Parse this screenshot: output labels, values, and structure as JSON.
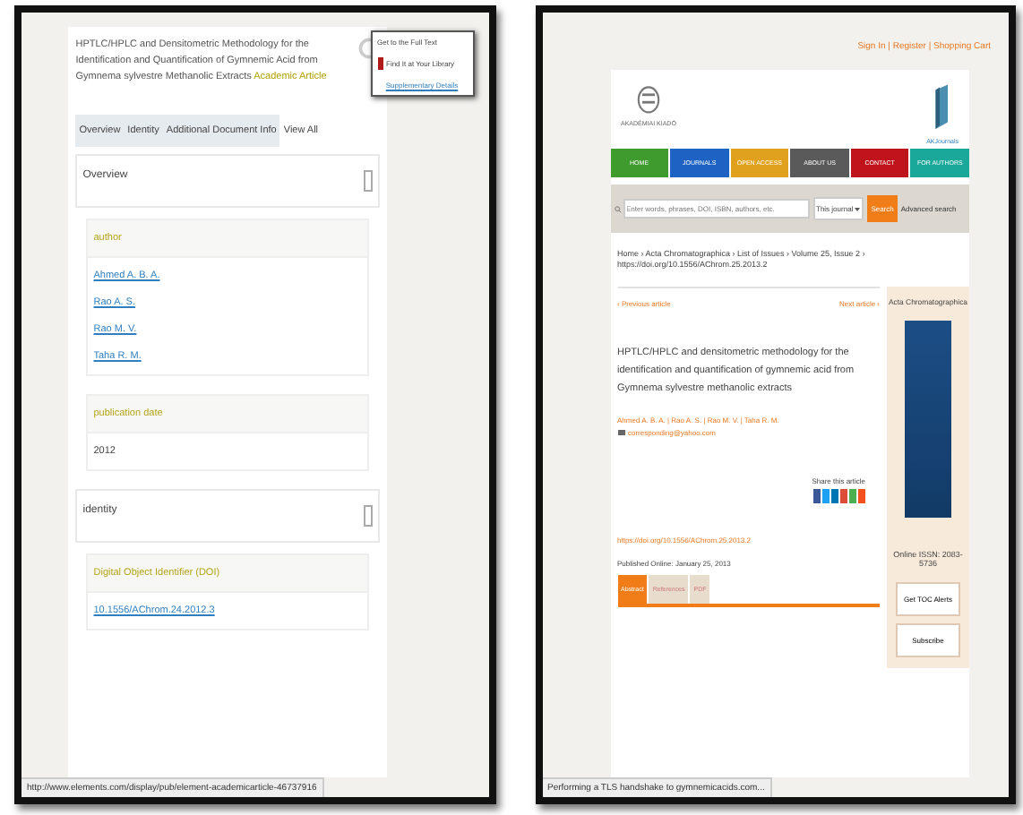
{
  "left": {
    "title": "HPTLC/HPLC and Densitometric Methodology for the Identification and Quantification of Gymnemic Acid from Gymnema sylvestre Methanolic Extracts",
    "badge": "Academic Article",
    "popup": {
      "items": [
        "Get to the Full Text",
        "Find It at Your Library"
      ],
      "link": "Supplementary Details"
    },
    "tabs": [
      {
        "label": "Overview",
        "selected": true
      },
      {
        "label": "Identity",
        "selected": true
      },
      {
        "label": "Additional Document Info",
        "selected": true
      },
      {
        "label": "View All",
        "selected": false
      }
    ],
    "sections": [
      {
        "title": "Overview",
        "groups": [
          {
            "heading": "author",
            "links": [
              "Ahmed A. B. A.",
              "Rao A. S.",
              "Rao M. V.",
              "Taha R. M."
            ]
          },
          {
            "heading": "publication date",
            "values": [
              "2012"
            ]
          }
        ]
      },
      {
        "title": "identity",
        "groups": [
          {
            "heading": "Digital Object Identifier (DOI)",
            "links": [
              "10.1556/AChrom.24.2012.3"
            ]
          }
        ]
      }
    ],
    "status": "http://www.elements.com/display/pub/element-academicarticle-46737916"
  },
  "right": {
    "top_links": "Sign In | Register | Shopping Cart",
    "publisher": "AKADÉMIAI KIADÓ",
    "brand": "AKJournals",
    "nav": [
      {
        "label": "HOME",
        "color": "#3f9b2e"
      },
      {
        "label": "JOURNALS",
        "color": "#1e63c4"
      },
      {
        "label": "OPEN ACCESS",
        "color": "#e0a21c"
      },
      {
        "label": "ABOUT US",
        "color": "#5a5a5a"
      },
      {
        "label": "CONTACT",
        "color": "#c0141c"
      },
      {
        "label": "FOR AUTHORS",
        "color": "#1aa89a"
      }
    ],
    "search": {
      "placeholder": "Enter words, phrases, DOI, ISBN, authors, etc.",
      "scope": "This journal",
      "button": "Search",
      "advanced": "Advanced search"
    },
    "breadcrumb": "Home › Acta Chromatographica › List of Issues › Volume 25, Issue 2 › https://doi.org/10.1556/AChrom.25.2013.2",
    "prev": "‹ Previous article",
    "next": "Next article ›",
    "title": "HPTLC/HPLC and densitometric methodology for the identification and quantification of gymnemic acid from Gymnema sylvestre methanolic extracts",
    "authors": "Ahmed A. B. A. | Rao A. S. | Rao M. V. | Taha R. M.",
    "email": "corresponding@yahoo.com",
    "share": "Share this article",
    "share_icons": [
      {
        "color": "#3b5998"
      },
      {
        "color": "#1da1f2"
      },
      {
        "color": "#0077b5"
      },
      {
        "color": "#dd4b39"
      },
      {
        "color": "#4caf50"
      },
      {
        "color": "#f4511e"
      }
    ],
    "doi": "https://doi.org/10.1556/AChrom.25.2013.2",
    "published": "Published Online: January 25, 2013",
    "tabs": [
      {
        "label": "Abstract",
        "selected": true
      },
      {
        "label": "References",
        "selected": false
      },
      {
        "label": "PDF",
        "selected": false
      }
    ],
    "sidebar": {
      "journal": "Acta Chromatographica",
      "issn": "Online ISSN: 2083-5736",
      "buttons": [
        "Get TOC Alerts",
        "Subscribe"
      ]
    },
    "status": "Performing a TLS handshake to gymnemicacids.com..."
  }
}
